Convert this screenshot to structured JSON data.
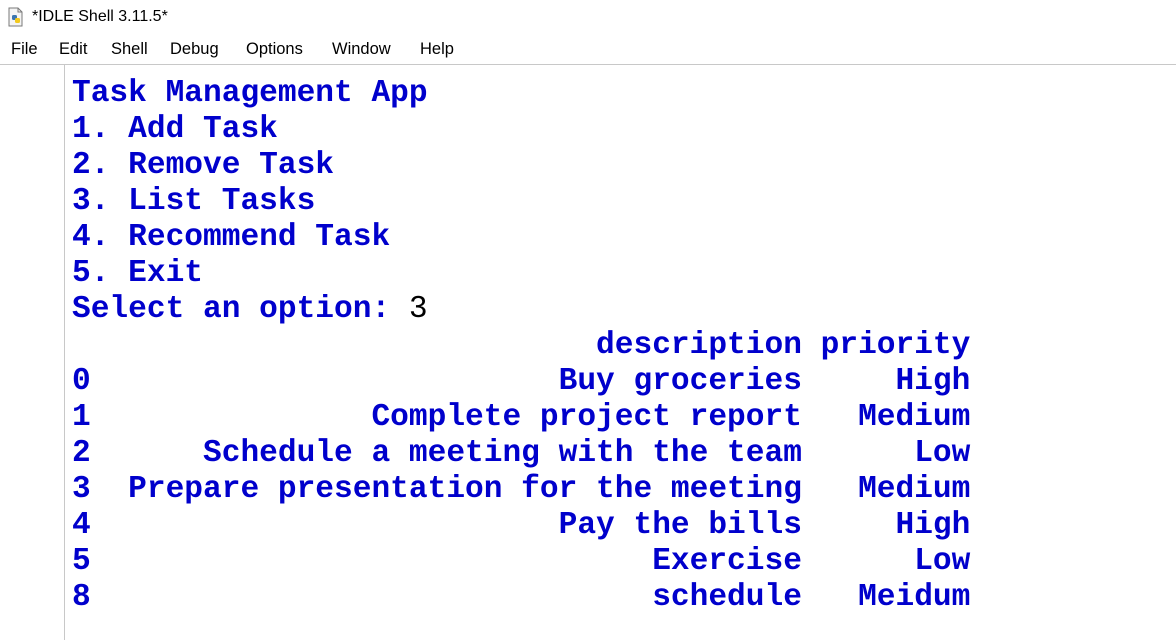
{
  "window": {
    "title": "*IDLE Shell 3.11.5*",
    "icon": "python-idle-icon"
  },
  "menu": [
    "File",
    "Edit",
    "Shell",
    "Debug",
    "Options",
    "Window",
    "Help"
  ],
  "shell": {
    "colors": {
      "output": "#0000cc",
      "input": "#000000"
    },
    "output_lines": [
      "Task Management App",
      "1. Add Task",
      "2. Remove Task",
      "3. List Tasks",
      "4. Recommend Task",
      "5. Exit"
    ],
    "prompt": {
      "text": "Select an option: ",
      "input": "3"
    },
    "table": {
      "columns": [
        "description",
        "priority"
      ],
      "rows": [
        {
          "index": "0",
          "description": "Buy groceries",
          "priority": "High"
        },
        {
          "index": "1",
          "description": "Complete project report",
          "priority": "Medium"
        },
        {
          "index": "2",
          "description": "Schedule a meeting with the team",
          "priority": "Low"
        },
        {
          "index": "3",
          "description": "Prepare presentation for the meeting",
          "priority": "Medium"
        },
        {
          "index": "4",
          "description": "Pay the bills",
          "priority": "High"
        },
        {
          "index": "5",
          "description": "Exercise",
          "priority": "Low"
        },
        {
          "index": "8",
          "description": "schedule",
          "priority": "Meidum"
        }
      ]
    }
  }
}
